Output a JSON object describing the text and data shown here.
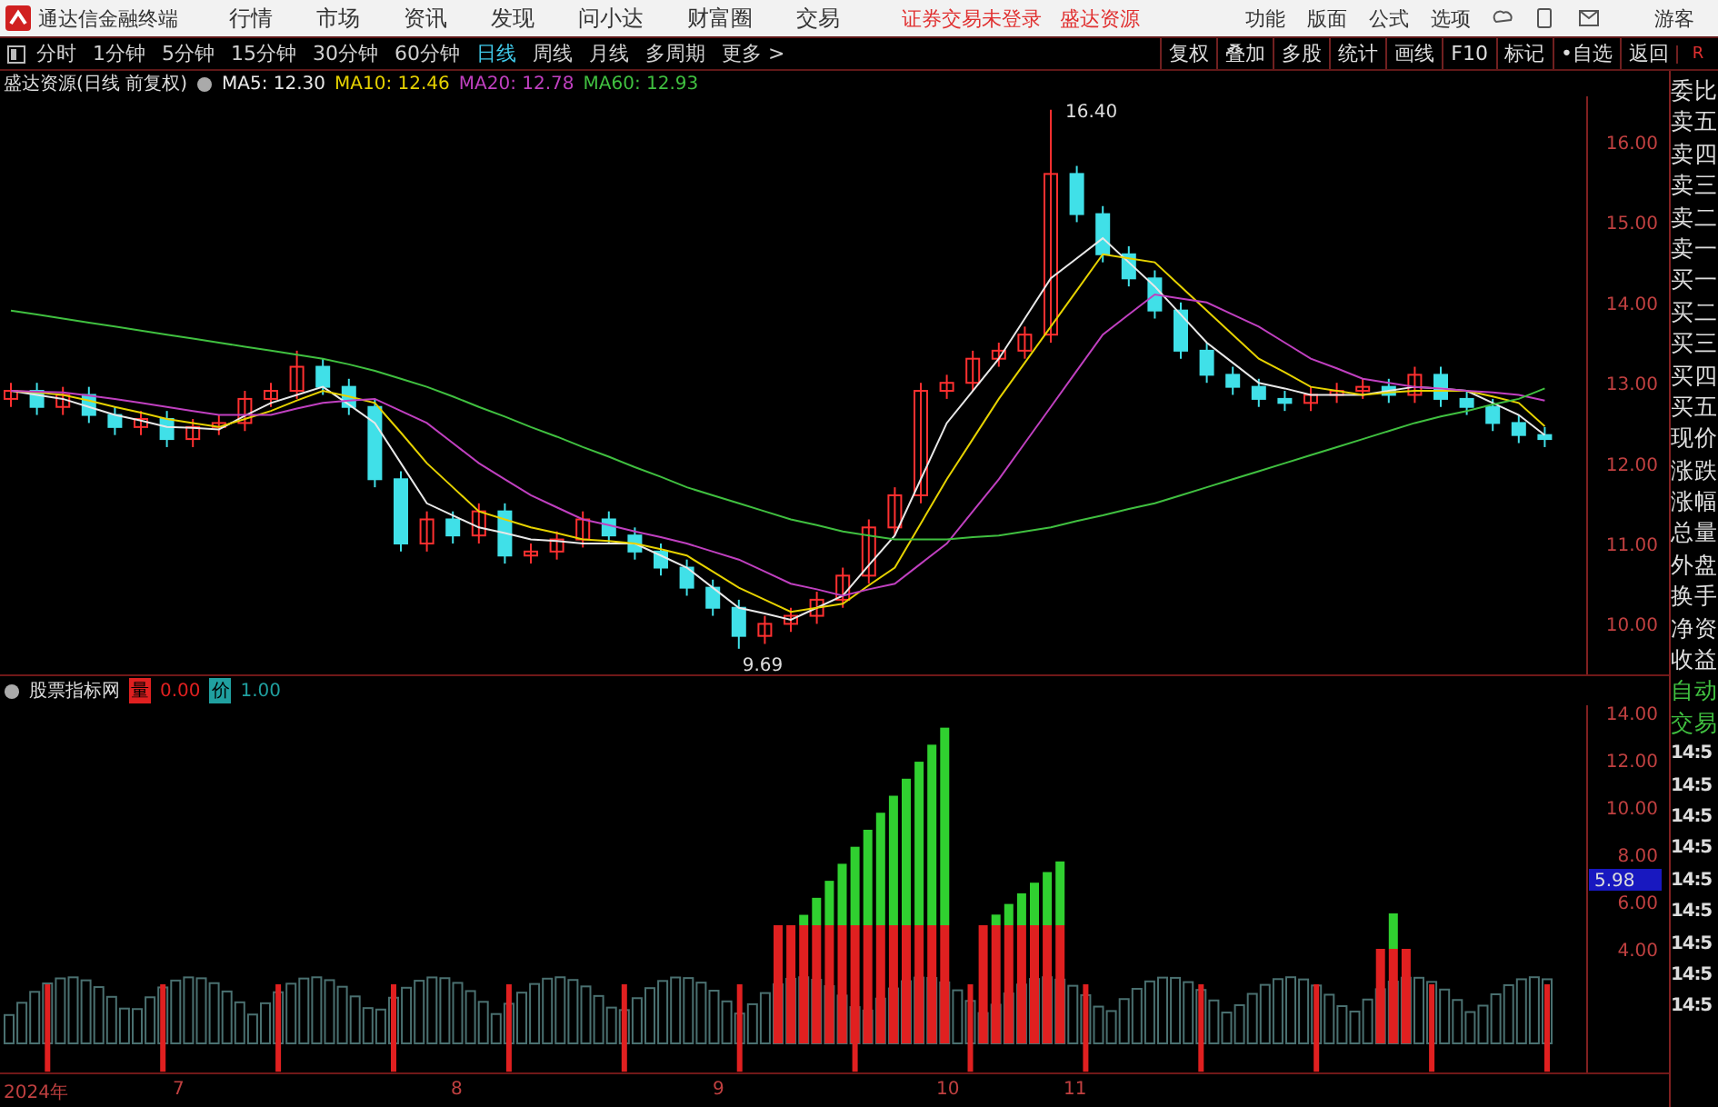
{
  "app": {
    "title": "通达信金融终端",
    "menu": [
      "行情",
      "市场",
      "资讯",
      "发现",
      "问小达",
      "财富圈",
      "交易"
    ],
    "notices": [
      "证券交易未登录",
      "盛达资源"
    ],
    "tools": [
      "功能",
      "版面",
      "公式",
      "选项"
    ],
    "user": "游客"
  },
  "periods": [
    {
      "label": "分时",
      "selected": false
    },
    {
      "label": "1分钟",
      "selected": false
    },
    {
      "label": "5分钟",
      "selected": false
    },
    {
      "label": "15分钟",
      "selected": false
    },
    {
      "label": "30分钟",
      "selected": false
    },
    {
      "label": "60分钟",
      "selected": false
    },
    {
      "label": "日线",
      "selected": true
    },
    {
      "label": "周线",
      "selected": false
    },
    {
      "label": "月线",
      "selected": false
    },
    {
      "label": "多周期",
      "selected": false
    },
    {
      "label": "更多 >",
      "selected": false
    }
  ],
  "actions": [
    "复权",
    "叠加",
    "多股",
    "统计",
    "画线",
    "F10",
    "标记",
    "•自选",
    "返回"
  ],
  "corner": "R",
  "chart": {
    "title": "盛达资源(日线 前复权)",
    "high_label": "16.40",
    "low_label": "9.69",
    "chart_data": {
      "type": "candlestick",
      "ylim": [
        9.371,
        16.566
      ],
      "yticks": [
        {
          "value": 16,
          "label": "16.00"
        },
        {
          "value": 15,
          "label": "15.00"
        },
        {
          "value": 14,
          "label": "14.00"
        },
        {
          "value": 13,
          "label": "13.00"
        },
        {
          "value": 12,
          "label": "12.00"
        },
        {
          "value": 11,
          "label": "11.00"
        },
        {
          "value": 10,
          "label": "10.00"
        }
      ],
      "ohlc": [
        [
          12.8,
          13.0,
          12.7,
          12.9
        ],
        [
          12.9,
          13.0,
          12.6,
          12.7
        ],
        [
          12.7,
          12.95,
          12.6,
          12.85
        ],
        [
          12.85,
          12.95,
          12.5,
          12.6
        ],
        [
          12.6,
          12.7,
          12.35,
          12.45
        ],
        [
          12.45,
          12.65,
          12.35,
          12.55
        ],
        [
          12.55,
          12.65,
          12.2,
          12.3
        ],
        [
          12.3,
          12.55,
          12.2,
          12.45
        ],
        [
          12.45,
          12.6,
          12.35,
          12.5
        ],
        [
          12.5,
          12.9,
          12.4,
          12.8
        ],
        [
          12.8,
          13.0,
          12.7,
          12.9
        ],
        [
          12.9,
          13.4,
          12.8,
          13.2
        ],
        [
          13.2,
          13.3,
          12.85,
          12.95
        ],
        [
          12.95,
          13.05,
          12.6,
          12.7
        ],
        [
          12.7,
          12.8,
          11.7,
          11.8
        ],
        [
          11.8,
          11.9,
          10.9,
          11.0
        ],
        [
          11.0,
          11.4,
          10.9,
          11.3
        ],
        [
          11.3,
          11.4,
          11.0,
          11.1
        ],
        [
          11.1,
          11.5,
          11.0,
          11.4
        ],
        [
          11.4,
          11.5,
          10.75,
          10.85
        ],
        [
          10.85,
          11.0,
          10.75,
          10.9
        ],
        [
          10.9,
          11.15,
          10.8,
          11.05
        ],
        [
          11.05,
          11.4,
          10.95,
          11.3
        ],
        [
          11.3,
          11.4,
          11.0,
          11.1
        ],
        [
          11.1,
          11.2,
          10.8,
          10.9
        ],
        [
          10.9,
          11.0,
          10.6,
          10.7
        ],
        [
          10.7,
          10.8,
          10.35,
          10.45
        ],
        [
          10.45,
          10.55,
          10.1,
          10.2
        ],
        [
          10.2,
          10.3,
          9.69,
          9.85
        ],
        [
          9.85,
          10.1,
          9.75,
          10.0
        ],
        [
          10.0,
          10.2,
          9.9,
          10.1
        ],
        [
          10.1,
          10.4,
          10.0,
          10.3
        ],
        [
          10.3,
          10.7,
          10.2,
          10.6
        ],
        [
          10.6,
          11.3,
          10.5,
          11.2
        ],
        [
          11.2,
          11.7,
          11.1,
          11.6
        ],
        [
          11.6,
          13.0,
          11.5,
          12.9
        ],
        [
          12.9,
          13.1,
          12.8,
          13.0
        ],
        [
          13.0,
          13.4,
          12.9,
          13.3
        ],
        [
          13.3,
          13.5,
          13.2,
          13.4
        ],
        [
          13.4,
          13.7,
          13.3,
          13.6
        ],
        [
          13.6,
          16.4,
          13.5,
          15.6
        ],
        [
          15.6,
          15.7,
          15.0,
          15.1
        ],
        [
          15.1,
          15.2,
          14.5,
          14.6
        ],
        [
          14.6,
          14.7,
          14.2,
          14.3
        ],
        [
          14.3,
          14.4,
          13.8,
          13.9
        ],
        [
          13.9,
          14.0,
          13.3,
          13.4
        ],
        [
          13.4,
          13.5,
          13.0,
          13.1
        ],
        [
          13.1,
          13.2,
          12.85,
          12.95
        ],
        [
          12.95,
          13.05,
          12.7,
          12.8
        ],
        [
          12.8,
          12.9,
          12.65,
          12.75
        ],
        [
          12.75,
          12.95,
          12.65,
          12.85
        ],
        [
          12.85,
          13.0,
          12.75,
          12.9
        ],
        [
          12.9,
          13.05,
          12.8,
          12.95
        ],
        [
          12.95,
          13.05,
          12.75,
          12.85
        ],
        [
          12.85,
          13.2,
          12.75,
          13.1
        ],
        [
          13.1,
          13.2,
          12.7,
          12.8
        ],
        [
          12.8,
          12.9,
          12.6,
          12.7
        ],
        [
          12.7,
          12.8,
          12.4,
          12.5
        ],
        [
          12.5,
          12.6,
          12.25,
          12.35
        ],
        [
          12.35,
          12.45,
          12.2,
          12.3
        ]
      ],
      "series": [
        {
          "name": "MA5: 12.30",
          "type": "line",
          "color": "#e8e8e8",
          "values": [
            12.9,
            12.85,
            12.8,
            12.7,
            12.6,
            12.53,
            12.45,
            12.44,
            12.42,
            12.59,
            12.75,
            12.85,
            12.95,
            12.73,
            12.5,
            12.0,
            11.5,
            11.35,
            11.2,
            11.13,
            11.05,
            11.03,
            11.0,
            11.0,
            11.0,
            10.85,
            10.7,
            10.45,
            10.2,
            10.13,
            10.05,
            10.2,
            10.35,
            10.73,
            11.1,
            11.8,
            12.5,
            12.9,
            13.3,
            13.8,
            14.3,
            14.55,
            14.8,
            14.5,
            14.2,
            13.85,
            13.5,
            13.25,
            13.0,
            12.93,
            12.85,
            12.85,
            12.85,
            12.9,
            12.95,
            12.93,
            12.9,
            12.75,
            12.6,
            12.35
          ]
        },
        {
          "name": "MA10: 12.46",
          "type": "line",
          "color": "#e6d200",
          "values": [
            12.9,
            12.88,
            12.85,
            12.78,
            12.7,
            12.63,
            12.55,
            12.5,
            12.45,
            12.55,
            12.65,
            12.78,
            12.9,
            12.83,
            12.75,
            12.38,
            12.0,
            11.7,
            11.4,
            11.3,
            11.2,
            11.13,
            11.05,
            11.03,
            11.0,
            10.93,
            10.85,
            10.65,
            10.45,
            10.3,
            10.15,
            10.2,
            10.25,
            10.48,
            10.7,
            11.25,
            11.8,
            12.3,
            12.8,
            13.25,
            13.7,
            14.15,
            14.6,
            14.55,
            14.5,
            14.2,
            13.9,
            13.6,
            13.3,
            13.13,
            12.95,
            12.9,
            12.85,
            12.88,
            12.9,
            12.9,
            12.9,
            12.83,
            12.75,
            12.46
          ]
        },
        {
          "name": "MA20: 12.78",
          "type": "line",
          "color": "#c040c0",
          "values": [
            12.9,
            12.89,
            12.88,
            12.84,
            12.8,
            12.75,
            12.7,
            12.65,
            12.6,
            12.6,
            12.6,
            12.68,
            12.75,
            12.78,
            12.8,
            12.65,
            12.5,
            12.25,
            12.0,
            11.8,
            11.6,
            11.45,
            11.3,
            11.23,
            11.15,
            11.08,
            11.0,
            10.9,
            10.8,
            10.65,
            10.5,
            10.43,
            10.35,
            10.43,
            10.5,
            10.75,
            11.0,
            11.4,
            11.8,
            12.25,
            12.7,
            13.15,
            13.6,
            13.85,
            14.1,
            14.05,
            14.0,
            13.85,
            13.7,
            13.5,
            13.3,
            13.18,
            13.05,
            13.0,
            12.95,
            12.93,
            12.9,
            12.88,
            12.85,
            12.78
          ]
        },
        {
          "name": "MA60: 12.93",
          "type": "line",
          "color": "#40c040",
          "values": [
            13.9,
            13.85,
            13.8,
            13.75,
            13.7,
            13.65,
            13.6,
            13.55,
            13.5,
            13.45,
            13.4,
            13.35,
            13.3,
            13.23,
            13.15,
            13.05,
            12.95,
            12.83,
            12.7,
            12.58,
            12.45,
            12.33,
            12.2,
            12.08,
            11.95,
            11.83,
            11.7,
            11.6,
            11.5,
            11.4,
            11.3,
            11.23,
            11.15,
            11.1,
            11.05,
            11.05,
            11.05,
            11.08,
            11.1,
            11.15,
            11.2,
            11.28,
            11.35,
            11.43,
            11.5,
            11.6,
            11.7,
            11.8,
            11.9,
            12.0,
            12.1,
            12.2,
            12.3,
            12.4,
            12.5,
            12.58,
            12.65,
            12.73,
            12.8,
            12.93
          ]
        }
      ]
    }
  },
  "indicator": {
    "title": "股票指标网",
    "items": [
      {
        "label": "量",
        "value": "0.00",
        "color": "#e02020"
      },
      {
        "label": "价",
        "value": "1.00",
        "color": "#20a0a0"
      }
    ],
    "yticks": [
      "14.00",
      "12.00",
      "10.00",
      "8.00",
      "6.00",
      "4.00"
    ],
    "cursor_label": "5.98"
  },
  "dates": [
    "2024年",
    "7",
    "8",
    "9",
    "10",
    "11"
  ],
  "quote_panel": [
    "委比",
    "卖五",
    "卖四",
    "卖三",
    "卖二",
    "卖一",
    "买一",
    "买二",
    "买三",
    "买四",
    "买五",
    "现价",
    "涨跌",
    "涨幅",
    "总量",
    "外盘",
    "换手",
    "净资",
    "收益",
    "自动",
    "交易",
    "14:5",
    "14:5",
    "14:5",
    "14:5",
    "14:5",
    "14:5",
    "14:5",
    "14:5",
    "14:5"
  ]
}
